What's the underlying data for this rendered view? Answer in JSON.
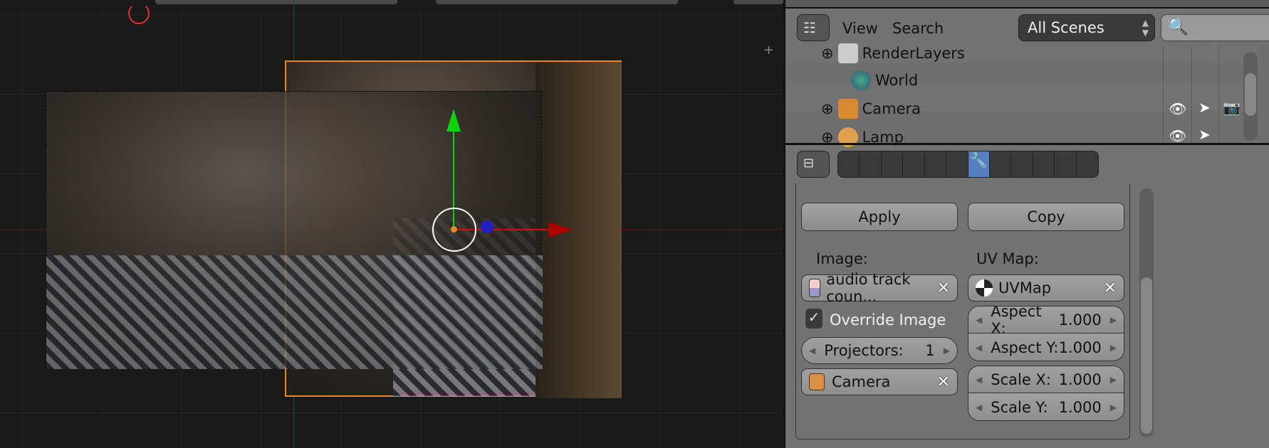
{
  "outliner": {
    "view_label": "View",
    "search_label": "Search",
    "scene_select": "All Scenes",
    "items": [
      {
        "label": "RenderLayers",
        "icon": "render-layers-icon"
      },
      {
        "label": "World",
        "icon": "world-icon"
      },
      {
        "label": "Camera",
        "icon": "camera-object-icon"
      },
      {
        "label": "Lamp",
        "icon": "lamp-icon"
      }
    ]
  },
  "properties": {
    "tabs": [
      "render",
      "render-layers",
      "scene",
      "world",
      "object",
      "constraints",
      "modifiers",
      "data",
      "material",
      "texture",
      "particles",
      "physics"
    ],
    "active_tab": "modifiers",
    "apply_label": "Apply",
    "copy_label": "Copy",
    "image_label": "Image:",
    "image_value": "audio track coun...",
    "override_label": "Override Image",
    "override_checked": true,
    "projectors_label": "Projectors:",
    "projectors_value": "1",
    "projector_object": "Camera",
    "uvmap_label": "UV Map:",
    "uvmap_value": "UVMap",
    "aspect_x_label": "Aspect X:",
    "aspect_x": "1.000",
    "aspect_y_label": "Aspect Y:",
    "aspect_y": "1.000",
    "scale_x_label": "Scale X:",
    "scale_x": "1.000",
    "scale_y_label": "Scale Y:",
    "scale_y": "1.000"
  },
  "colors": {
    "accent": "#5680c2",
    "selection": "#f09030",
    "x_axis": "#cc1010",
    "y_axis": "#20c020"
  }
}
